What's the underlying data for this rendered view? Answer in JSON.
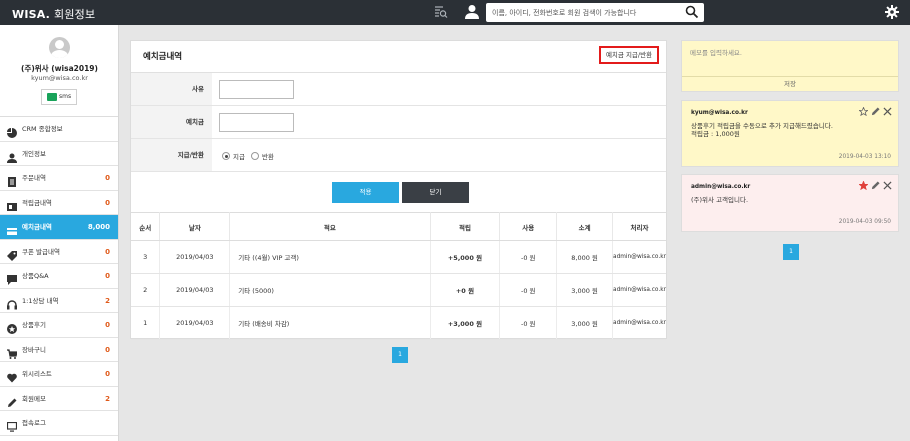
{
  "header": {
    "brand": "WISA.",
    "title": "회원정보",
    "search_placeholder": "이름, 아이디, 전화번호로 회원 검색이 가능합니다"
  },
  "profile": {
    "name": "(주)위사 (wisa2019)",
    "email": "kyum@wisa.co.kr",
    "sms_label": "sms"
  },
  "sidebar": {
    "items": [
      {
        "label": "CRM 종합정보",
        "count": "",
        "icon": "pie-chart-icon"
      },
      {
        "label": "개인정보",
        "count": "",
        "icon": "person-icon"
      },
      {
        "label": "주문내역",
        "count": "0",
        "icon": "order-list-icon"
      },
      {
        "label": "적립금내역",
        "count": "0",
        "icon": "reward-icon"
      },
      {
        "label": "예치금내역",
        "count": "8,000",
        "icon": "deposit-card-icon",
        "active": true
      },
      {
        "label": "쿠폰 발급내역",
        "count": "0",
        "icon": "coupon-icon"
      },
      {
        "label": "상품Q&A",
        "count": "0",
        "icon": "chat-bubble-icon"
      },
      {
        "label": "1:1상담 내역",
        "count": "2",
        "icon": "headset-icon"
      },
      {
        "label": "상품후기",
        "count": "0",
        "icon": "review-icon"
      },
      {
        "label": "장바구니",
        "count": "0",
        "icon": "cart-icon"
      },
      {
        "label": "위시리스트",
        "count": "0",
        "icon": "heart-icon"
      },
      {
        "label": "회원메모",
        "count": "2",
        "icon": "pencil-icon"
      },
      {
        "label": "접속로그",
        "count": "",
        "icon": "monitor-icon"
      }
    ]
  },
  "panel": {
    "title": "예치금내역",
    "charge_button": "예치금 지급/반환",
    "form": {
      "reason_label": "사유",
      "amount_label": "예치금",
      "type_label": "지급/반환",
      "opt_give": "지급",
      "opt_return": "반환"
    },
    "apply_button": "적용",
    "close_button": "닫기",
    "table": {
      "headers": [
        "순서",
        "날자",
        "적요",
        "적립",
        "사용",
        "소계",
        "처리자"
      ],
      "rows": [
        [
          "3",
          "2019/04/03",
          "기타 ((4월) VIP 고객)",
          "+5,000 원",
          "-0 원",
          "8,000 원",
          "admin@wisa.co.kr"
        ],
        [
          "2",
          "2019/04/03",
          "기타 (5000)",
          "+0 원",
          "-0 원",
          "3,000 원",
          "admin@wisa.co.kr"
        ],
        [
          "1",
          "2019/04/03",
          "기타 (배송비 차감)",
          "+3,000 원",
          "-0 원",
          "3,000 원",
          "admin@wisa.co.kr"
        ]
      ]
    },
    "page": "1"
  },
  "memo": {
    "placeholder": "메모를 입력하세요.",
    "save_label": "저장",
    "cards": [
      {
        "author": "kyum@wisa.co.kr",
        "text": "상품후기 적립금을 수동으로 추가 지급해드렸습니다.\n적립금 : 1,000원",
        "date": "2019-04-03 13:10",
        "bg": "#fff8c8",
        "starred": false
      },
      {
        "author": "admin@wisa.co.kr",
        "text": "(주)위사 고객입니다.",
        "date": "2019-04-03 09:50",
        "bg": "#fdeeee",
        "starred": true
      }
    ],
    "page": "1"
  },
  "colors": {
    "accent": "#29a8df",
    "dark": "#2b3036",
    "count": "#e05a1a",
    "highlight": "#e31b1b"
  }
}
